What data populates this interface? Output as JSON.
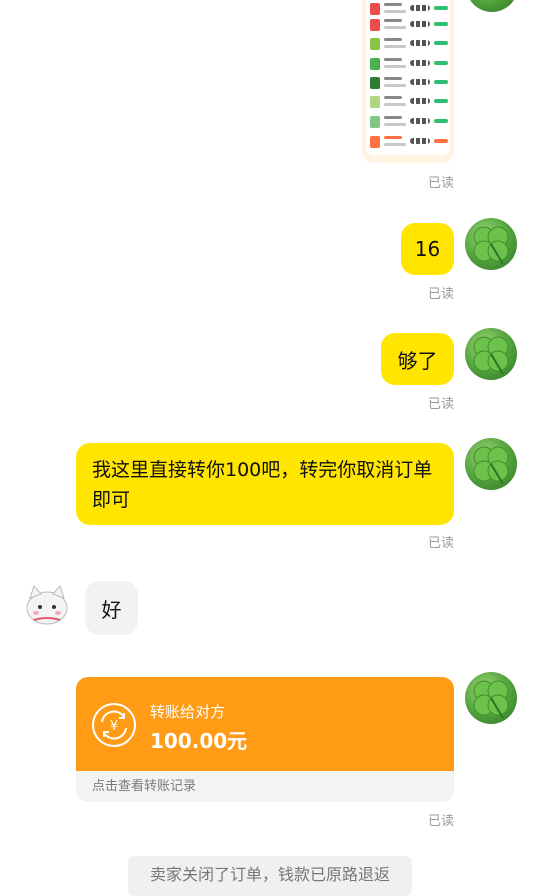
{
  "messages": {
    "read_label": "已读",
    "msg_16": "16",
    "msg_enough": "够了",
    "msg_long": "我这里直接转你100吧，转完你取消订单即可",
    "msg_ok": "好"
  },
  "transfer": {
    "title": "转账给对方",
    "amount": "100.00元",
    "record_link": "点击查看转账记录",
    "icon": "yen-exchange-icon"
  },
  "system_notice": "卖家关闭了订单，钱款已原路退返",
  "colors": {
    "bubble_self": "#ffe500",
    "bubble_other": "#f1f2f4",
    "transfer_orange": "#ff9b14"
  }
}
